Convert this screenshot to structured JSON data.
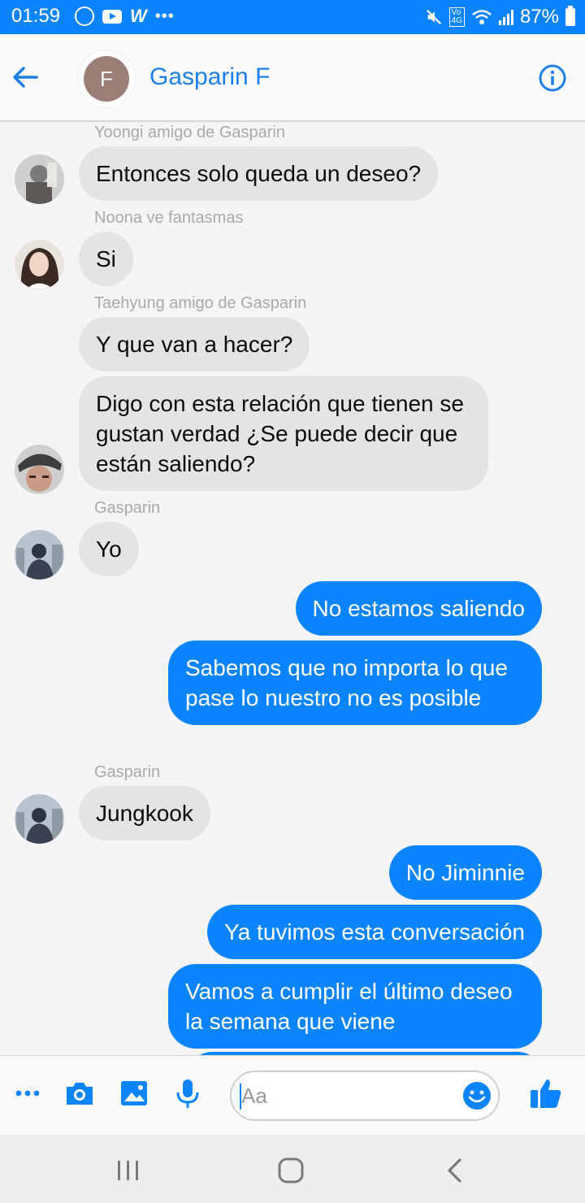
{
  "status_bar": {
    "time": "01:59",
    "battery": "87%",
    "left_icons": [
      "whatsapp-icon",
      "youtube-icon",
      "w-icon",
      "more-dots"
    ],
    "right_icons": [
      "mute-icon",
      "volte-icon",
      "wifi-icon",
      "signal-icon",
      "battery-icon"
    ]
  },
  "header": {
    "avatar_initial": "F",
    "title": "Gasparin F",
    "back_icon": "arrow-left-icon",
    "info_icon": "info-icon"
  },
  "messages": [
    {
      "sender": "Yoongi amigo de Gasparin",
      "text": "Entonces solo queda un deseo?",
      "side": "in"
    },
    {
      "sender": "Noona ve fantasmas",
      "text": "Si",
      "side": "in"
    },
    {
      "sender": "Taehyung amigo de Gasparin",
      "text": "Y que van a hacer?",
      "side": "in"
    },
    {
      "sender": "",
      "text": "Digo con esta relación que tienen se gustan verdad ¿Se puede decir que están saliendo?",
      "side": "in"
    },
    {
      "sender": "Gasparin",
      "text": "Yo",
      "side": "in"
    },
    {
      "sender": "",
      "text": "No estamos saliendo",
      "side": "out"
    },
    {
      "sender": "",
      "text": "Sabemos que no importa lo que pase lo nuestro no es posible",
      "side": "out"
    },
    {
      "sender": "Gasparin",
      "text": "Jungkook",
      "side": "in"
    },
    {
      "sender": "",
      "text": "No Jiminnie",
      "side": "out"
    },
    {
      "sender": "",
      "text": "Ya tuvimos esta conversación",
      "side": "out"
    },
    {
      "sender": "",
      "text": "Vamos a cumplir el último deseo la semana que viene",
      "side": "out"
    }
  ],
  "composer": {
    "placeholder": "Aa",
    "tools": [
      "more-icon",
      "camera-icon",
      "image-icon",
      "microphone-icon"
    ],
    "emoji_icon": "smiley-icon",
    "like_icon": "thumbs-up-icon"
  },
  "colors": {
    "accent": "#0a84ff",
    "incoming_bubble": "#e4e4e6",
    "title": "#1c7fe8",
    "sender_label": "#a9a9a9"
  },
  "navbar": [
    "recent-apps-icon",
    "home-icon",
    "back-icon"
  ]
}
